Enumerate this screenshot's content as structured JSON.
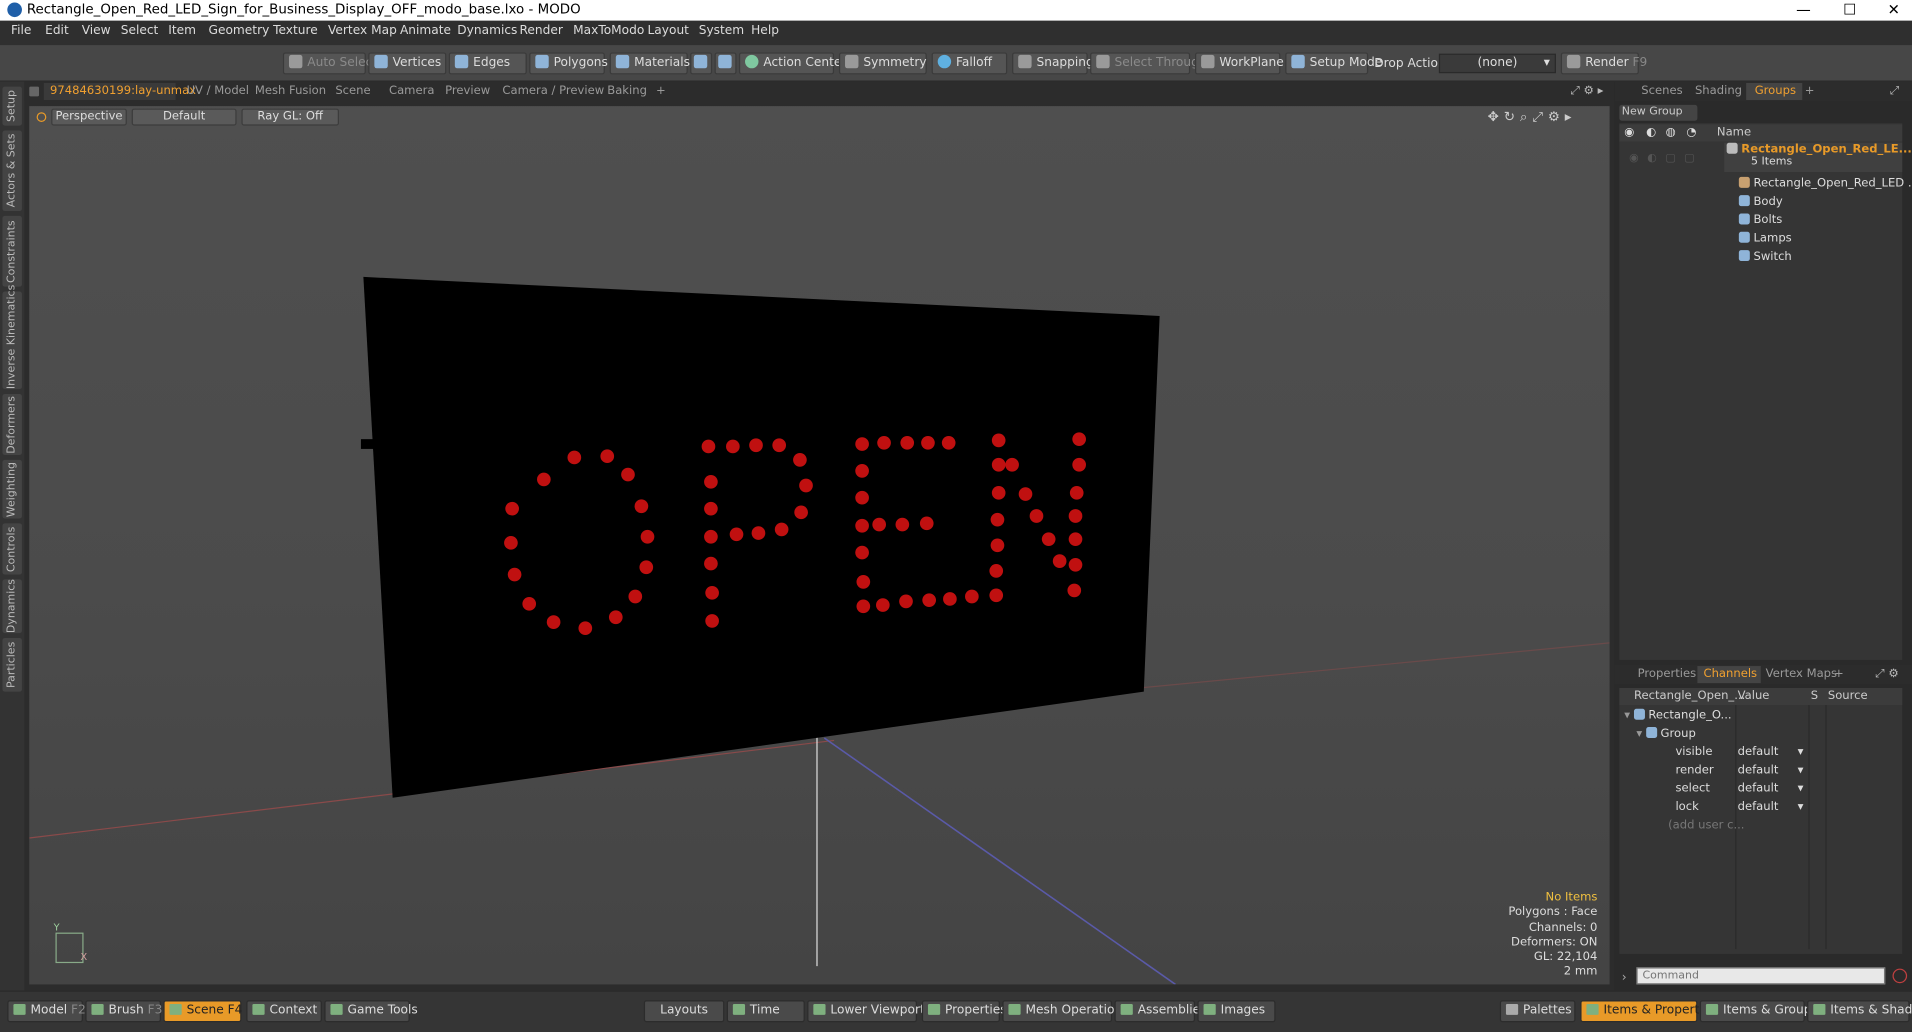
{
  "window": {
    "title": "Rectangle_Open_Red_LED_Sign_for_Business_Display_OFF_modo_base.lxo - MODO",
    "minimize": "—",
    "maximize": "☐",
    "close": "✕"
  },
  "menu": [
    "File",
    "Edit",
    "View",
    "Select",
    "Item",
    "Geometry",
    "Texture",
    "Vertex Map",
    "Animate",
    "Dynamics",
    "Render",
    "MaxToModo",
    "Layout",
    "System",
    "Help"
  ],
  "toolbar": {
    "auto_select": "Auto Select",
    "vertices": "Vertices",
    "edges": "Edges",
    "polygons": "Polygons",
    "materials": "Materials",
    "action_center": "Action Center",
    "symmetry": "Symmetry",
    "falloff": "Falloff",
    "snapping": "Snapping",
    "select_through": "Select Through",
    "workplane": "WorkPlane",
    "setup_mode": "Setup Mode",
    "drop_action": "Drop Action",
    "drop_value": "(none)",
    "render": "Render",
    "render_key": "F9"
  },
  "view_tabs": [
    "97484630199:lay-unmax",
    "UV / Model",
    "Mesh Fusion",
    "Scene",
    "Camera",
    "Preview",
    "Camera / Preview",
    "Baking",
    "+"
  ],
  "left_tabs": [
    "Setup",
    "Actors & Sets",
    "Constraints",
    "Inverse Kinematics",
    "Deformers",
    "Weighting",
    "Controls",
    "Dynamics",
    "Particles"
  ],
  "viewport": {
    "view_mode": "Perspective",
    "shading": "Default",
    "raygl": "Ray GL: Off",
    "scene_text": "OPEN",
    "info": {
      "items": "No Items",
      "polygons": "Polygons : Face",
      "channels": "Channels: 0",
      "deformers": "Deformers: ON",
      "gl": "GL: 22,104",
      "unit": "2 mm"
    },
    "axis_y": "Y",
    "axis_x": "X"
  },
  "scene_panel": {
    "tabs": [
      "Scenes",
      "Shading",
      "Groups",
      "+"
    ],
    "new_group": "New Group",
    "col_name": "Name",
    "group_name": "Rectangle_Open_Red_LE...",
    "group_count": "5 Items",
    "items": [
      {
        "label": "Rectangle_Open_Red_LED ...",
        "icon": "locator-icon"
      },
      {
        "label": "Body",
        "icon": "mesh-icon"
      },
      {
        "label": "Bolts",
        "icon": "mesh-icon"
      },
      {
        "label": "Lamps",
        "icon": "mesh-icon"
      },
      {
        "label": "Switch",
        "icon": "mesh-icon"
      }
    ]
  },
  "props_panel": {
    "tabs": [
      "Properties",
      "Channels",
      "Vertex Maps",
      "+"
    ],
    "col_item": "Rectangle_Open_...",
    "col_value": "Value",
    "col_s": "S",
    "col_source": "Source",
    "root": "Rectangle_O...",
    "group": "Group",
    "channels": [
      {
        "name": "visible",
        "value": "default"
      },
      {
        "name": "render",
        "value": "default"
      },
      {
        "name": "select",
        "value": "default"
      },
      {
        "name": "lock",
        "value": "default"
      }
    ],
    "add_user": "(add user c..."
  },
  "command": {
    "placeholder": "Command"
  },
  "bottom": {
    "model": "Model",
    "model_key": "F2",
    "brush": "Brush",
    "brush_key": "F3",
    "scene": "Scene",
    "scene_key": "F4",
    "context": "Context",
    "game_tools": "Game Tools",
    "layouts": "Layouts",
    "time": "Time",
    "lower_viewports": "Lower Viewports",
    "properties": "Properties",
    "mesh_operations": "Mesh Operations",
    "assemblies": "Assemblies",
    "images": "Images",
    "palettes": "Palettes",
    "items_properties": "Items & Properties",
    "items_groups": "Items & Groups",
    "items_shading": "Items & Shading"
  },
  "colors": {
    "accent": "#e89a28",
    "led": "#c01010",
    "sign": "#000000"
  }
}
